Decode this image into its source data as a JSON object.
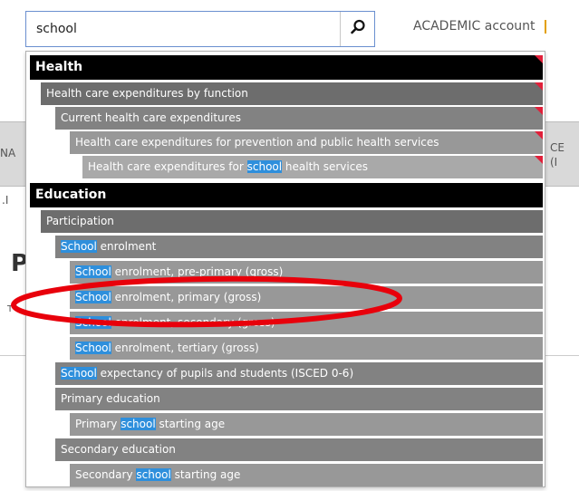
{
  "search": {
    "value": "school",
    "button_icon": "search-icon"
  },
  "header": {
    "account_label": "ACADEMIC account"
  },
  "background": {
    "frag_na": "NA",
    "frag_ce": "CE",
    "frag_i": "(I",
    "frag_l": ".I",
    "big_letter": "P",
    "frag_small": "T"
  },
  "results": {
    "health": {
      "label": "Health",
      "expenditure_by_function": "Health care expenditures by function",
      "current_expenditures": "Current health care expenditures",
      "prevention": "Health care expenditures for prevention and public health services",
      "school_health": {
        "pre": "Health care expenditures for ",
        "match": "school",
        "post": " health services"
      }
    },
    "education": {
      "label": "Education",
      "participation": "Participation",
      "enrolment": {
        "match": "School",
        "post": " enrolment"
      },
      "pre_primary": {
        "match": "School",
        "post": " enrolment, pre-primary (gross)"
      },
      "primary": {
        "match": "School",
        "post": " enrolment, primary (gross)"
      },
      "secondary": {
        "match": "School",
        "post": " enrolment, secondary (gross)"
      },
      "tertiary": {
        "match": "School",
        "post": " enrolment, tertiary (gross)"
      },
      "expectancy": {
        "match": "School",
        "post": " expectancy of pupils and students (ISCED 0-6)"
      },
      "primary_education": "Primary education",
      "primary_start": {
        "pre": "Primary ",
        "match": "school",
        "post": " starting age"
      },
      "secondary_education": "Secondary education",
      "secondary_start": {
        "pre": "Secondary ",
        "match": "school",
        "post": " starting age"
      }
    }
  },
  "colors": {
    "highlight": "#2e8fdc",
    "annotation": "#e8000b",
    "category": "#000000"
  }
}
